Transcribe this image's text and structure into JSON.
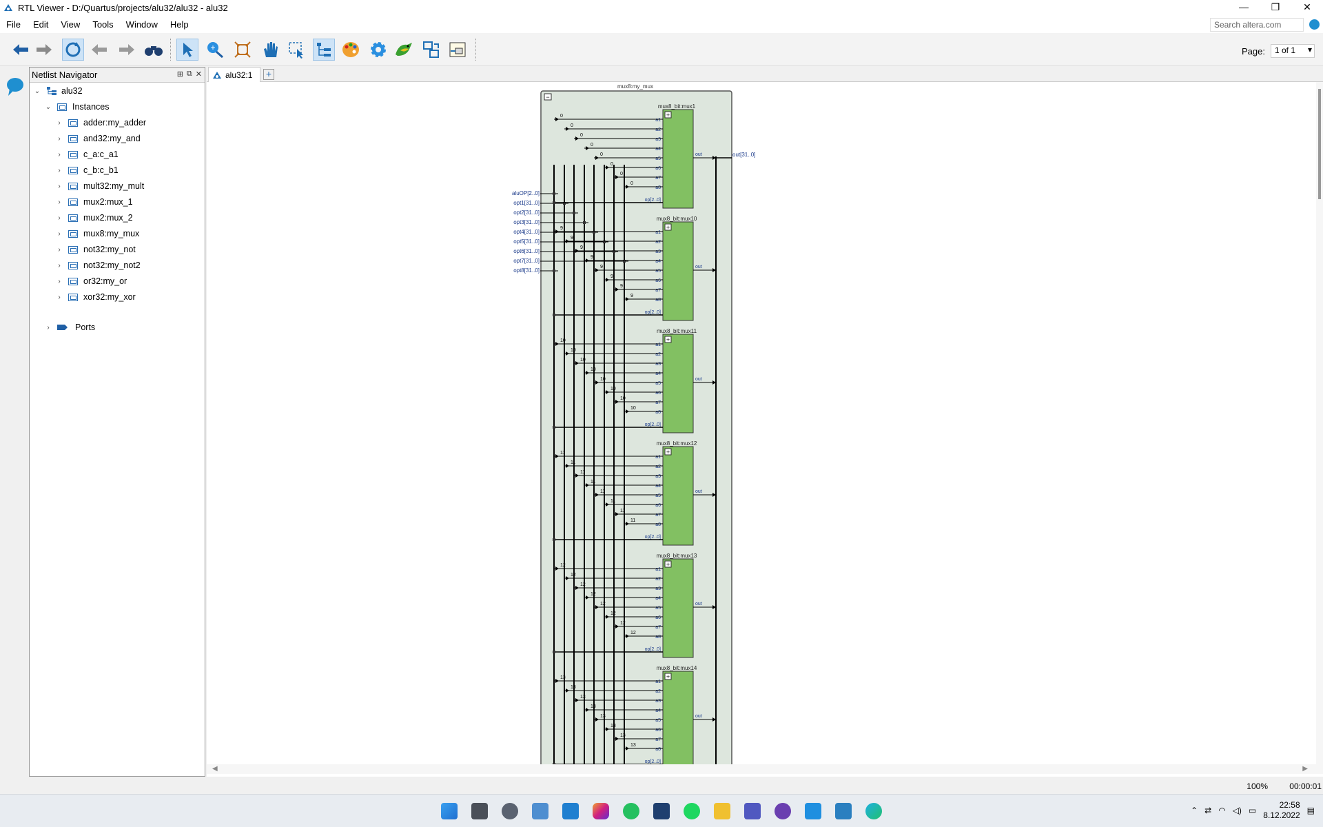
{
  "window": {
    "title": "RTL Viewer - D:/Quartus/projects/alu32/alu32 - alu32",
    "controls": [
      "—",
      "❐",
      "✕"
    ]
  },
  "menu": {
    "items": [
      "File",
      "Edit",
      "View",
      "Tools",
      "Window",
      "Help"
    ],
    "search_placeholder": "Search altera.com"
  },
  "toolbar": {
    "buttons": [
      "back-icon",
      "forward-disabled-icon",
      "refresh-icon",
      "step-back-icon",
      "step-forward-icon",
      "binoculars-icon",
      "select-pointer-icon",
      "zoom-icon",
      "fit-window-icon",
      "hand-pan-icon",
      "rubberband-select-icon",
      "hierarchy-icon",
      "palette-icon",
      "gear-icon",
      "bird-icon",
      "export-icon",
      "netlist-icon"
    ],
    "page_label": "Page:",
    "page_value": "1 of 1"
  },
  "navigator": {
    "title": "Netlist Navigator",
    "root": "alu32",
    "instances_label": "Instances",
    "instances": [
      "adder:my_adder",
      "and32:my_and",
      "c_a:c_a1",
      "c_b:c_b1",
      "mult32:my_mult",
      "mux2:mux_1",
      "mux2:mux_2",
      "mux8:my_mux",
      "not32:my_not",
      "not32:my_not2",
      "or32:my_or",
      "xor32:my_xor"
    ],
    "ports_label": "Ports"
  },
  "tabs": {
    "active": "alu32:1",
    "add": "+"
  },
  "schematic": {
    "container_label": "mux8:my_mux",
    "inputs": [
      "aluOP[2..0]",
      "opt1[31..0]",
      "opt2[31..0]",
      "opt3[31..0]",
      "opt4[31..0]",
      "opt5[31..0]",
      "opt6[31..0]",
      "opt7[31..0]",
      "opt8[31..0]"
    ],
    "output": "out[31..0]",
    "mux_ports": [
      "a1",
      "a2",
      "a3",
      "a4",
      "a5",
      "a6",
      "a7",
      "a8"
    ],
    "op_port": "op[2..0]",
    "out_port": "out",
    "blocks": [
      {
        "name": "mux8_bit:mux1",
        "bit": "0"
      },
      {
        "name": "mux8_bit:mux10",
        "bit": "9"
      },
      {
        "name": "mux8_bit:mux11",
        "bit": "10"
      },
      {
        "name": "mux8_bit:mux12",
        "bit": "11"
      },
      {
        "name": "mux8_bit:mux13",
        "bit": "12"
      },
      {
        "name": "mux8_bit:mux14",
        "bit": "13"
      }
    ]
  },
  "status": {
    "zoom": "100%",
    "elapsed": "00:00:01"
  },
  "tray": {
    "time": "22:58",
    "date": "8.12.2022"
  },
  "colors": {
    "mux_fill": "#82c062",
    "container_fill": "#dde6dd",
    "wire": "#000000",
    "label": "#1a3a8a"
  }
}
